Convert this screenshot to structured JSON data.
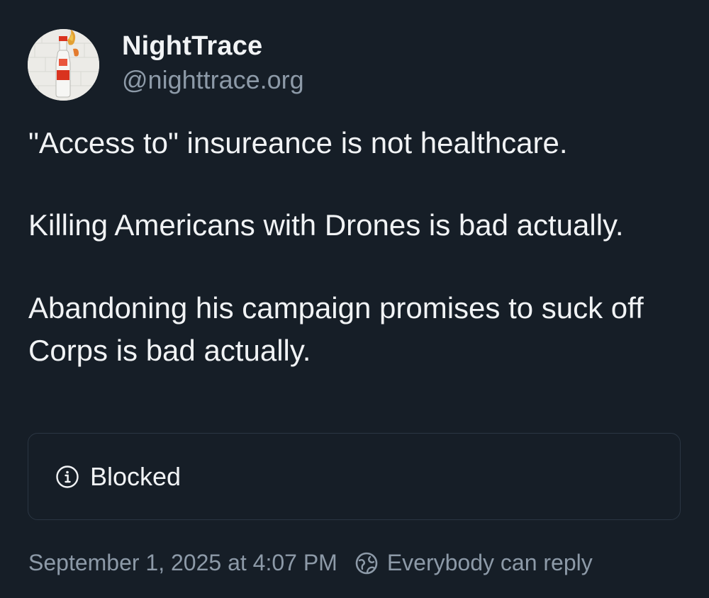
{
  "author": {
    "display_name": "NightTrace",
    "handle": "@nighttrace.org",
    "avatar_icon": "vodka-bottle-avatar"
  },
  "post": {
    "paragraphs": [
      "\"Access to\" insureance is not healthcare.",
      "Killing Americans with Drones is bad actually.",
      "Abandoning his campaign promises to suck off Corps is bad actually."
    ]
  },
  "embed": {
    "icon": "info-icon",
    "label": "Blocked"
  },
  "footer": {
    "timestamp": "September 1, 2025 at 4:07 PM",
    "reply_icon": "globe-reply-icon",
    "reply_setting": "Everybody can reply"
  },
  "colors": {
    "background": "#161e27",
    "text": "#f1f3f5",
    "muted": "#8d9aa8",
    "border": "#2b3643"
  }
}
